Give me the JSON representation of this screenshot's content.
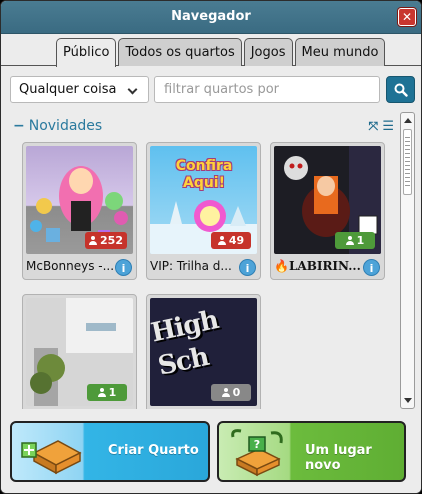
{
  "window": {
    "title": "Navegador"
  },
  "tabs": [
    {
      "label": "Público",
      "active": true
    },
    {
      "label": "Todos os quartos",
      "active": false
    },
    {
      "label": "Jogos",
      "active": false
    },
    {
      "label": "Meu mundo",
      "active": false
    }
  ],
  "filter": {
    "selected": "Qualquer coisa",
    "placeholder": "filtrar quartos por"
  },
  "section": {
    "title": "Novidades"
  },
  "rooms": [
    {
      "name": "McBonneys -...",
      "users": "252",
      "badge": "red"
    },
    {
      "name": "VIP: Trilha d...",
      "users": "49",
      "badge": "red"
    },
    {
      "name": "LABIRIN...",
      "users": "1",
      "badge": "green"
    },
    {
      "name": "",
      "users": "1",
      "badge": "green"
    },
    {
      "name": "",
      "users": "0",
      "badge": "gray"
    }
  ],
  "thumb_texts": {
    "room2": "Confira Aqui!",
    "room5": "High Sch"
  },
  "footer": {
    "create_label": "Criar Quarto",
    "random_label": "Um lugar novo"
  },
  "colors": {
    "title_bar": "#3f7088",
    "accent": "#1e7295",
    "badge_red": "#c6332b",
    "badge_green": "#4e9a3a",
    "create_btn": "#35b8e8",
    "random_btn": "#69b83a"
  }
}
